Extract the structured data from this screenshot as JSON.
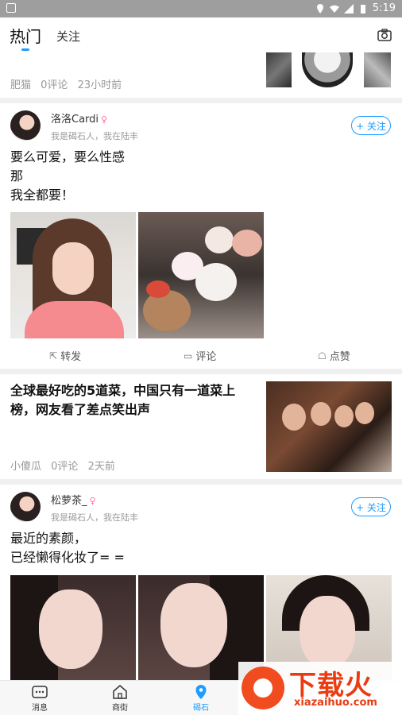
{
  "statusbar": {
    "time": "5:19"
  },
  "topnav": {
    "tab_hot": "热门",
    "tab_follow": "关注"
  },
  "card0": {
    "author": "肥猫",
    "comments": "0评论",
    "time": "23小时前"
  },
  "post1": {
    "username": "洛洛Cardi",
    "gender": "♀",
    "subtitle": "我是碣石人，我在陆丰",
    "follow_label": "+ 关注",
    "text": "要么可爱，要么性感\n那\n我全都要！",
    "actions": {
      "share": "转发",
      "comment": "评论",
      "like": "点赞"
    }
  },
  "news": {
    "title": "全球最好吃的5道菜，中国只有一道菜上榜，网友看了差点笑出声",
    "author": "小傻瓜",
    "comments": "0评论",
    "time": "2天前"
  },
  "post2": {
    "username": "松萝茶_",
    "gender": "♀",
    "subtitle": "我是碣石人，我在陆丰",
    "follow_label": "+ 关注",
    "text": "最近的素颜，\n已经懒得化妆了= ="
  },
  "tabbar": {
    "items": [
      {
        "label": "消息",
        "icon": "message-icon"
      },
      {
        "label": "商街",
        "icon": "store-icon"
      },
      {
        "label": "碣石",
        "icon": "location-icon"
      }
    ]
  },
  "watermark": {
    "cn": "下载火",
    "en": "xiazaihuo.com"
  },
  "colors": {
    "accent": "#1e9cff",
    "female": "#ff6f9e",
    "watermark": "#ea3b11"
  }
}
